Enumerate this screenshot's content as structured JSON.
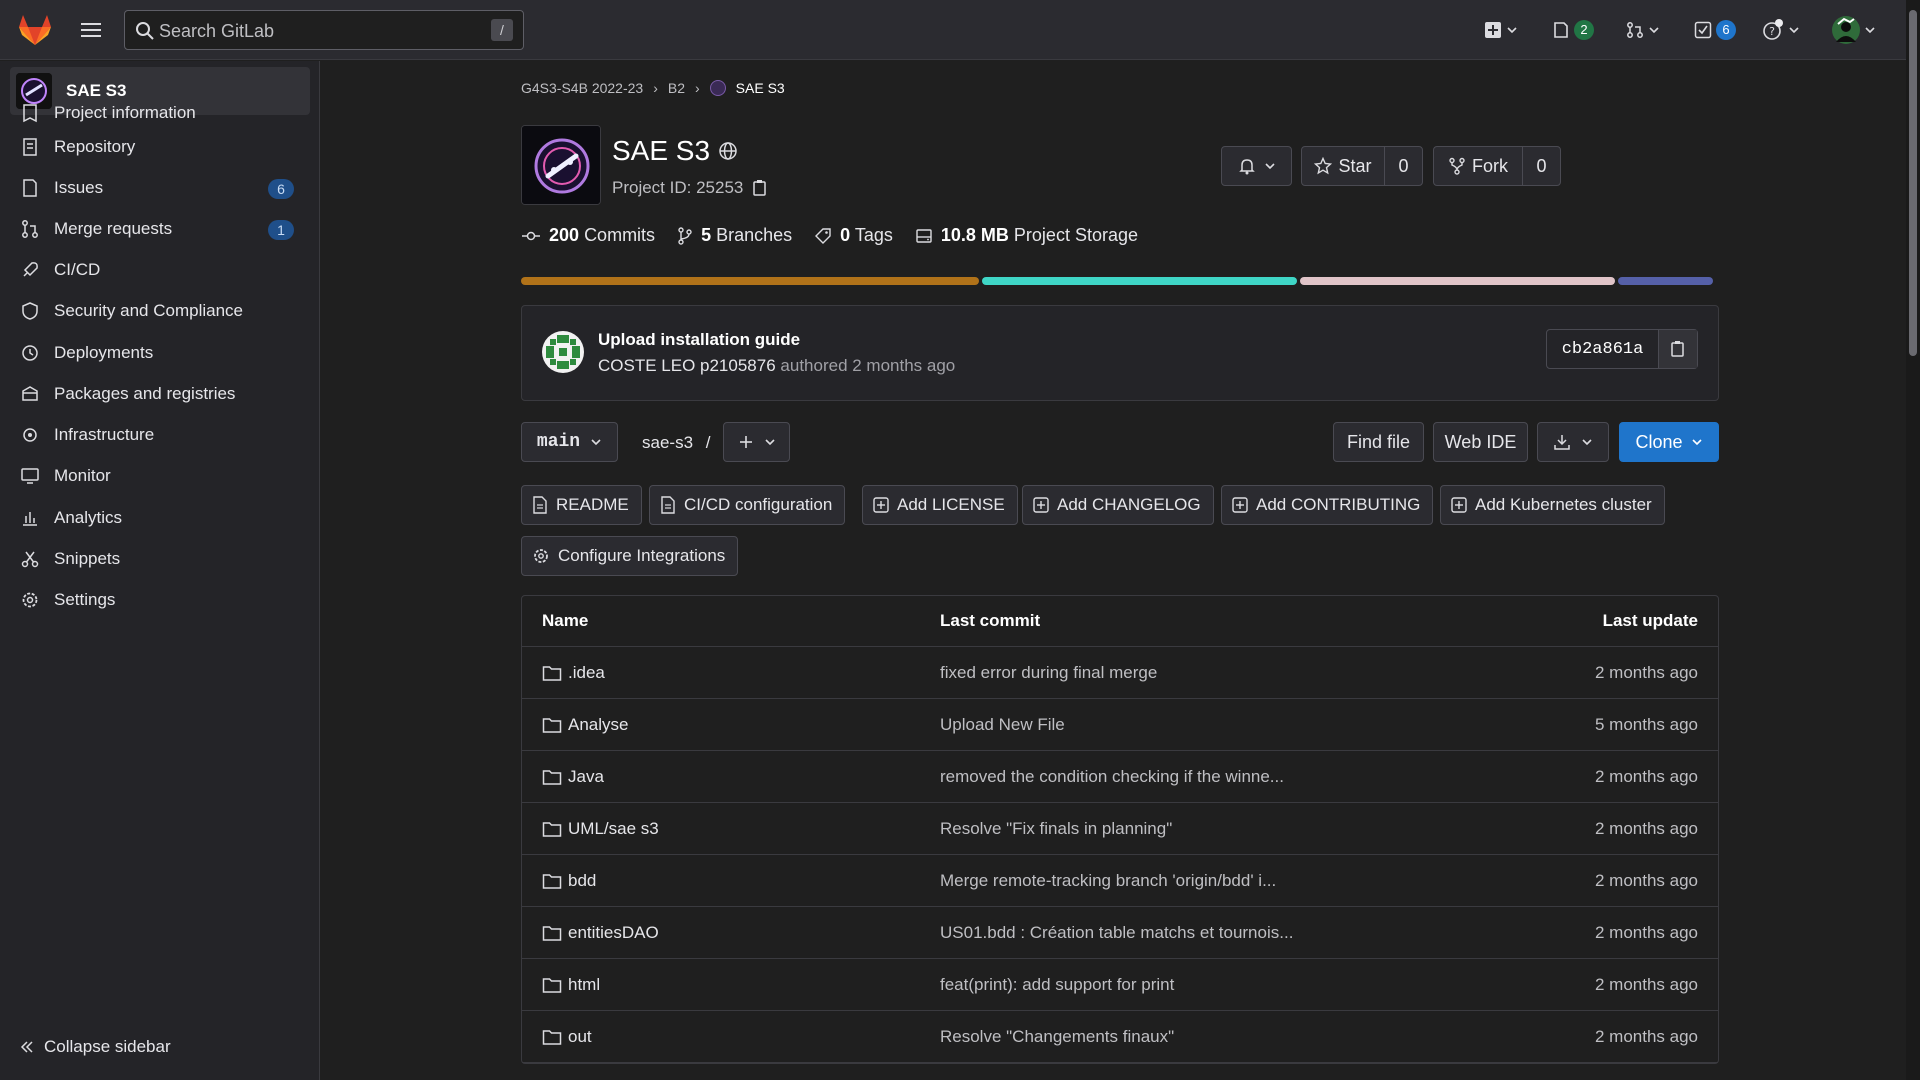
{
  "topbar": {
    "search_placeholder": "Search GitLab",
    "search_shortcut": "/",
    "issues_count": "2",
    "todos_count": "6"
  },
  "sidebar": {
    "project_name": "SAE S3",
    "items": [
      {
        "label": "Project information"
      },
      {
        "label": "Repository"
      },
      {
        "label": "Issues",
        "badge": "6"
      },
      {
        "label": "Merge requests",
        "badge": "1"
      },
      {
        "label": "CI/CD"
      },
      {
        "label": "Security and Compliance"
      },
      {
        "label": "Deployments"
      },
      {
        "label": "Packages and registries"
      },
      {
        "label": "Infrastructure"
      },
      {
        "label": "Monitor"
      },
      {
        "label": "Analytics"
      },
      {
        "label": "Snippets"
      },
      {
        "label": "Settings"
      }
    ],
    "collapse_label": "Collapse sidebar"
  },
  "breadcrumb": {
    "group": "G4S3-S4B 2022-23",
    "subgroup": "B2",
    "current": "SAE S3"
  },
  "project": {
    "title": "SAE S3",
    "id_label": "Project ID: 25253",
    "star_label": "Star",
    "star_count": "0",
    "fork_label": "Fork",
    "fork_count": "0"
  },
  "stats": {
    "commits_num": "200",
    "commits_label": "Commits",
    "branches_num": "5",
    "branches_label": "Branches",
    "tags_num": "0",
    "tags_label": "Tags",
    "storage_num": "10.8 MB",
    "storage_label": "Project Storage"
  },
  "languages": [
    {
      "color": "#b07219",
      "share": 0.385
    },
    {
      "color": "#3fd6c6",
      "share": 0.265
    },
    {
      "color": "#e0c4c8",
      "share": 0.265
    },
    {
      "color": "#5560a8",
      "share": 0.08
    }
  ],
  "last_commit": {
    "title": "Upload installation guide",
    "author": "COSTE LEO p2105876",
    "authored": "authored 2 months ago",
    "sha": "cb2a861a"
  },
  "repo_controls": {
    "branch": "main",
    "path": "sae-s3",
    "path_sep": "/",
    "find_file": "Find file",
    "web_ide": "Web IDE",
    "clone": "Clone"
  },
  "actions": [
    {
      "label": "README",
      "icon": "file-icon"
    },
    {
      "label": "CI/CD configuration",
      "icon": "file-icon"
    },
    {
      "label": "Add LICENSE",
      "icon": "plus-square-icon"
    },
    {
      "label": "Add CHANGELOG",
      "icon": "plus-square-icon"
    },
    {
      "label": "Add CONTRIBUTING",
      "icon": "plus-square-icon"
    },
    {
      "label": "Add Kubernetes cluster",
      "icon": "plus-square-icon"
    },
    {
      "label": "Configure Integrations",
      "icon": "gear-icon"
    }
  ],
  "files": {
    "headers": {
      "name": "Name",
      "commit": "Last commit",
      "update": "Last update"
    },
    "rows": [
      {
        "name": ".idea",
        "commit": "fixed error during final merge",
        "update": "2 months ago"
      },
      {
        "name": "Analyse",
        "commit": "Upload New File",
        "update": "5 months ago"
      },
      {
        "name": "Java",
        "commit": "removed the condition checking if the winne...",
        "update": "2 months ago"
      },
      {
        "name": "UML/sae s3",
        "commit": "Resolve \"Fix finals in planning\"",
        "update": "2 months ago"
      },
      {
        "name": "bdd",
        "commit": "Merge remote-tracking branch 'origin/bdd' i...",
        "update": "2 months ago"
      },
      {
        "name": "entitiesDAO",
        "commit": "US01.bdd : Création table matchs et tournois...",
        "update": "2 months ago"
      },
      {
        "name": "html",
        "commit": "feat(print): add support for print",
        "update": "2 months ago"
      },
      {
        "name": "out",
        "commit": "Resolve \"Changements finaux\"",
        "update": "2 months ago"
      }
    ]
  }
}
